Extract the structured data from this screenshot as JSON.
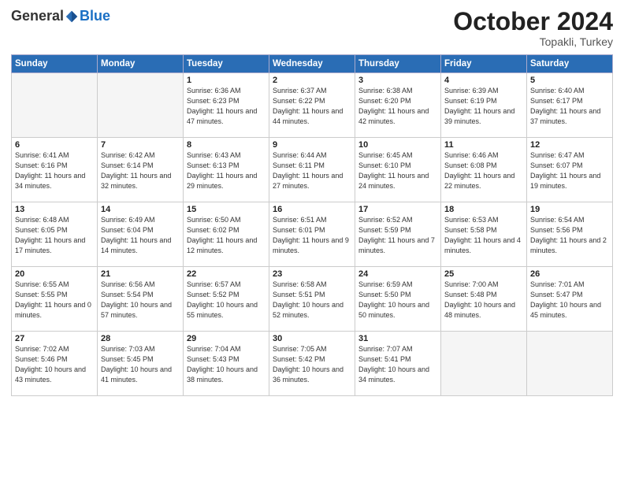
{
  "header": {
    "logo_general": "General",
    "logo_blue": "Blue",
    "month": "October 2024",
    "location": "Topakli, Turkey"
  },
  "weekdays": [
    "Sunday",
    "Monday",
    "Tuesday",
    "Wednesday",
    "Thursday",
    "Friday",
    "Saturday"
  ],
  "weeks": [
    [
      {
        "day": "",
        "info": ""
      },
      {
        "day": "",
        "info": ""
      },
      {
        "day": "1",
        "info": "Sunrise: 6:36 AM\nSunset: 6:23 PM\nDaylight: 11 hours and 47 minutes."
      },
      {
        "day": "2",
        "info": "Sunrise: 6:37 AM\nSunset: 6:22 PM\nDaylight: 11 hours and 44 minutes."
      },
      {
        "day": "3",
        "info": "Sunrise: 6:38 AM\nSunset: 6:20 PM\nDaylight: 11 hours and 42 minutes."
      },
      {
        "day": "4",
        "info": "Sunrise: 6:39 AM\nSunset: 6:19 PM\nDaylight: 11 hours and 39 minutes."
      },
      {
        "day": "5",
        "info": "Sunrise: 6:40 AM\nSunset: 6:17 PM\nDaylight: 11 hours and 37 minutes."
      }
    ],
    [
      {
        "day": "6",
        "info": "Sunrise: 6:41 AM\nSunset: 6:16 PM\nDaylight: 11 hours and 34 minutes."
      },
      {
        "day": "7",
        "info": "Sunrise: 6:42 AM\nSunset: 6:14 PM\nDaylight: 11 hours and 32 minutes."
      },
      {
        "day": "8",
        "info": "Sunrise: 6:43 AM\nSunset: 6:13 PM\nDaylight: 11 hours and 29 minutes."
      },
      {
        "day": "9",
        "info": "Sunrise: 6:44 AM\nSunset: 6:11 PM\nDaylight: 11 hours and 27 minutes."
      },
      {
        "day": "10",
        "info": "Sunrise: 6:45 AM\nSunset: 6:10 PM\nDaylight: 11 hours and 24 minutes."
      },
      {
        "day": "11",
        "info": "Sunrise: 6:46 AM\nSunset: 6:08 PM\nDaylight: 11 hours and 22 minutes."
      },
      {
        "day": "12",
        "info": "Sunrise: 6:47 AM\nSunset: 6:07 PM\nDaylight: 11 hours and 19 minutes."
      }
    ],
    [
      {
        "day": "13",
        "info": "Sunrise: 6:48 AM\nSunset: 6:05 PM\nDaylight: 11 hours and 17 minutes."
      },
      {
        "day": "14",
        "info": "Sunrise: 6:49 AM\nSunset: 6:04 PM\nDaylight: 11 hours and 14 minutes."
      },
      {
        "day": "15",
        "info": "Sunrise: 6:50 AM\nSunset: 6:02 PM\nDaylight: 11 hours and 12 minutes."
      },
      {
        "day": "16",
        "info": "Sunrise: 6:51 AM\nSunset: 6:01 PM\nDaylight: 11 hours and 9 minutes."
      },
      {
        "day": "17",
        "info": "Sunrise: 6:52 AM\nSunset: 5:59 PM\nDaylight: 11 hours and 7 minutes."
      },
      {
        "day": "18",
        "info": "Sunrise: 6:53 AM\nSunset: 5:58 PM\nDaylight: 11 hours and 4 minutes."
      },
      {
        "day": "19",
        "info": "Sunrise: 6:54 AM\nSunset: 5:56 PM\nDaylight: 11 hours and 2 minutes."
      }
    ],
    [
      {
        "day": "20",
        "info": "Sunrise: 6:55 AM\nSunset: 5:55 PM\nDaylight: 11 hours and 0 minutes."
      },
      {
        "day": "21",
        "info": "Sunrise: 6:56 AM\nSunset: 5:54 PM\nDaylight: 10 hours and 57 minutes."
      },
      {
        "day": "22",
        "info": "Sunrise: 6:57 AM\nSunset: 5:52 PM\nDaylight: 10 hours and 55 minutes."
      },
      {
        "day": "23",
        "info": "Sunrise: 6:58 AM\nSunset: 5:51 PM\nDaylight: 10 hours and 52 minutes."
      },
      {
        "day": "24",
        "info": "Sunrise: 6:59 AM\nSunset: 5:50 PM\nDaylight: 10 hours and 50 minutes."
      },
      {
        "day": "25",
        "info": "Sunrise: 7:00 AM\nSunset: 5:48 PM\nDaylight: 10 hours and 48 minutes."
      },
      {
        "day": "26",
        "info": "Sunrise: 7:01 AM\nSunset: 5:47 PM\nDaylight: 10 hours and 45 minutes."
      }
    ],
    [
      {
        "day": "27",
        "info": "Sunrise: 7:02 AM\nSunset: 5:46 PM\nDaylight: 10 hours and 43 minutes."
      },
      {
        "day": "28",
        "info": "Sunrise: 7:03 AM\nSunset: 5:45 PM\nDaylight: 10 hours and 41 minutes."
      },
      {
        "day": "29",
        "info": "Sunrise: 7:04 AM\nSunset: 5:43 PM\nDaylight: 10 hours and 38 minutes."
      },
      {
        "day": "30",
        "info": "Sunrise: 7:05 AM\nSunset: 5:42 PM\nDaylight: 10 hours and 36 minutes."
      },
      {
        "day": "31",
        "info": "Sunrise: 7:07 AM\nSunset: 5:41 PM\nDaylight: 10 hours and 34 minutes."
      },
      {
        "day": "",
        "info": ""
      },
      {
        "day": "",
        "info": ""
      }
    ]
  ]
}
